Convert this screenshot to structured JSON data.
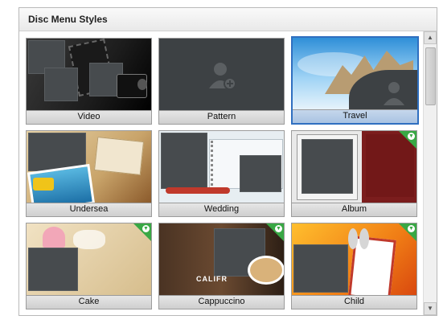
{
  "panel": {
    "title": "Disc Menu Styles"
  },
  "tiles": [
    {
      "label": "Video",
      "selected": false,
      "download": false
    },
    {
      "label": "Pattern",
      "selected": false,
      "download": false
    },
    {
      "label": "Travel",
      "selected": true,
      "download": false
    },
    {
      "label": "Undersea",
      "selected": false,
      "download": false
    },
    {
      "label": "Wedding",
      "selected": false,
      "download": false
    },
    {
      "label": "Album",
      "selected": false,
      "download": true
    },
    {
      "label": "Cake",
      "selected": false,
      "download": true
    },
    {
      "label": "Cappuccino",
      "selected": false,
      "download": true
    },
    {
      "label": "Child",
      "selected": false,
      "download": true
    }
  ],
  "artwork_text": {
    "cappuccino_sign": "CALIFR"
  },
  "colors": {
    "selection": "#2f6fc0",
    "download_badge": "#39a845",
    "tile_bg": "#3d4144"
  },
  "icons": {
    "download": "download-badge-icon",
    "placeholder": "person-add-placeholder-icon"
  }
}
